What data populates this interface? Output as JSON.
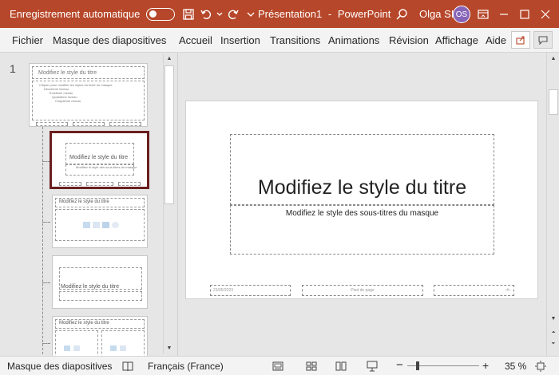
{
  "titlebar": {
    "autosave_label": "Enregistrement automatique",
    "autosave_state": "off",
    "document_title": "Présentation1",
    "separator": "-",
    "app_name": "PowerPoint",
    "user_name": "Olga SI",
    "user_initials": "OS",
    "brand_color": "#b7472a",
    "icons": [
      "save-icon",
      "undo-icon",
      "chevron-down-icon",
      "redo-icon",
      "customize-icon",
      "search-icon",
      "ribbon-display-icon",
      "minimize-icon",
      "maximize-icon",
      "close-icon"
    ]
  },
  "ribbon": {
    "tabs": [
      "Fichier",
      "Masque des diapositives",
      "Accueil",
      "Insertion",
      "Transitions",
      "Animations",
      "Révision",
      "Affichage",
      "Aide"
    ],
    "right_icons": [
      "share-icon",
      "comments-icon"
    ]
  },
  "thumbnails": {
    "first_number": "1",
    "master": {
      "title": "Modifiez le style du titre",
      "body": "Cliquez pour modifier les styles du texte du masque",
      "level2": "Deuxième niveau",
      "level3": "Troisième niveau",
      "level4": "Quatrième niveau",
      "level5": "Cinquième niveau"
    },
    "layout_title": "Modifiez le style du titre",
    "layout_subtitle": "Modifiez le style des sous-titres du masque",
    "layout3_title": "Modifiez le style du titre",
    "layout4_title": "Modifiez le style du titre",
    "layout5_title": "Modifiez le style du titre",
    "selected_border_color": "#6b1f1f"
  },
  "slide": {
    "title": "Modifiez le style du titre",
    "subtitle": "Modifiez le style des sous-titres du masque",
    "date": "23/05/2023",
    "footer": "Pied de page",
    "page_number": "‹#›"
  },
  "statusbar": {
    "view_label": "Masque des diapositives",
    "language": "Français (France)",
    "zoom_level": "35 %",
    "zoom_fraction": 0.35,
    "icons": [
      "proofing-icon",
      "normal-view-icon",
      "slide-sorter-icon",
      "reading-view-icon",
      "slideshow-icon",
      "zoom-out-icon",
      "zoom-in-icon",
      "fit-slide-icon"
    ]
  }
}
